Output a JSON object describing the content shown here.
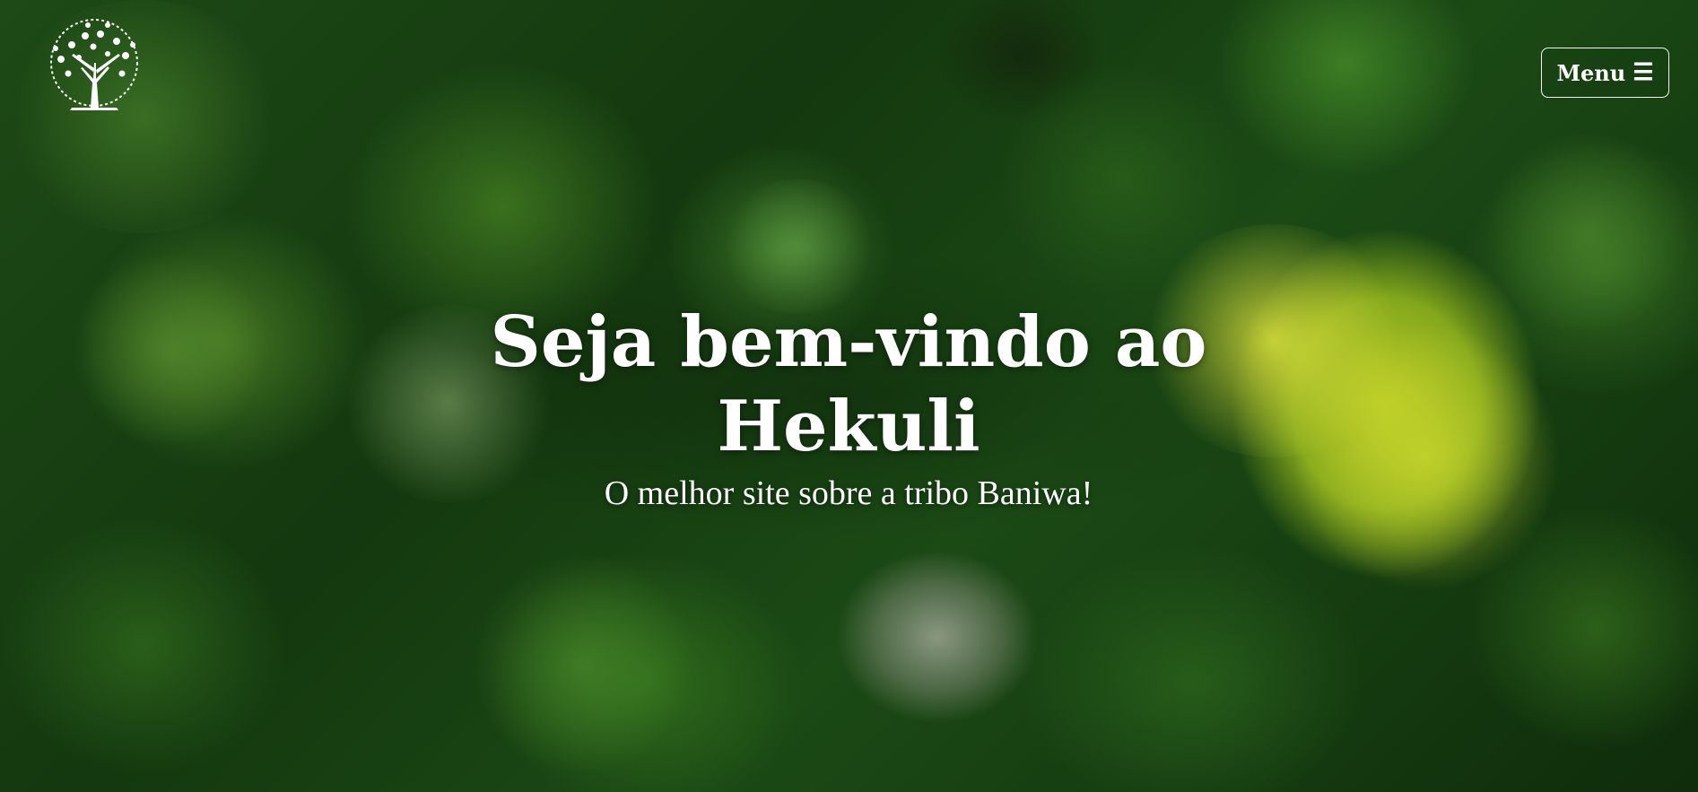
{
  "header": {
    "logo_icon": "tree-icon",
    "menu": {
      "label": "Menu",
      "icon": "hamburger-icon",
      "icon_glyph": "☰"
    }
  },
  "hero": {
    "title": "Seja bem-vindo ao Hekuli",
    "subtitle": "O melhor site sobre a tribo Baniwa!"
  },
  "colors": {
    "text": "#ffffff",
    "foliage_dark": "#14380f",
    "foliage_yellow": "#c4d228"
  }
}
